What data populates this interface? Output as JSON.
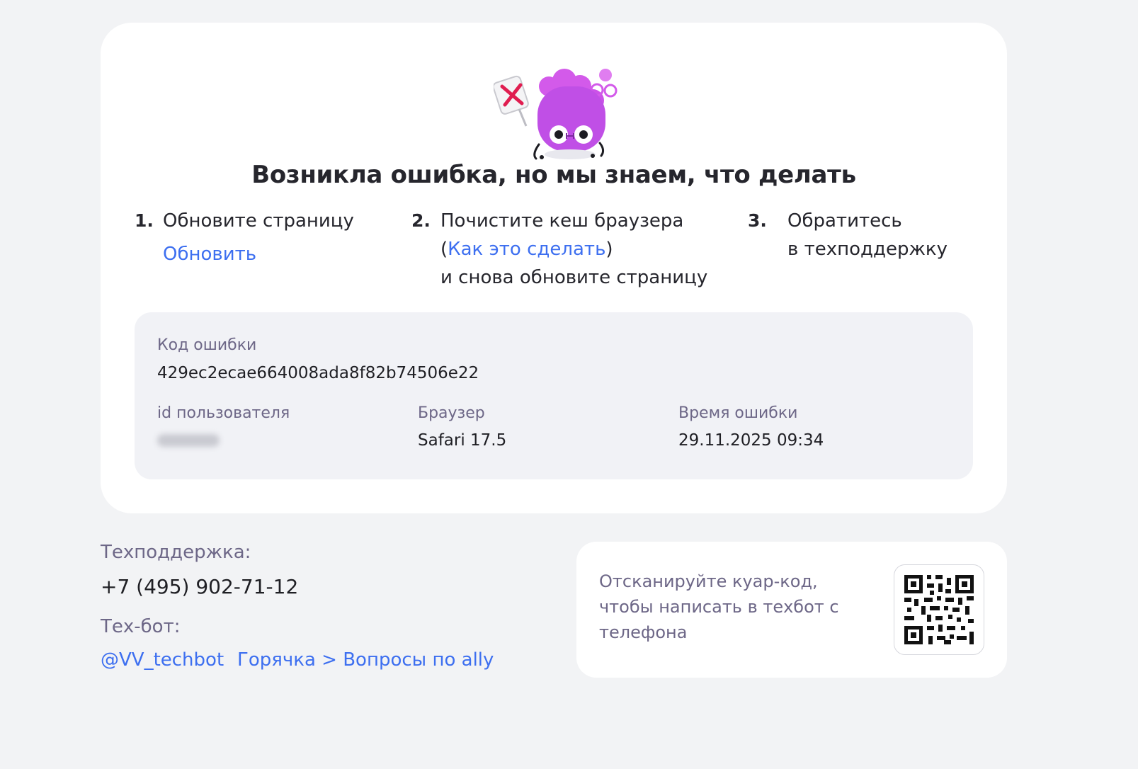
{
  "title": "Возникла ошибка, но мы знаем, что делать",
  "steps": [
    {
      "num": "1.",
      "text": "Обновите страницу",
      "link": "Обновить"
    },
    {
      "num": "2.",
      "line1": "Почистите кеш браузера",
      "paren_open": "(",
      "link": "Как это сделать",
      "paren_close": ")",
      "line3": "и снова обновите страницу"
    },
    {
      "num": "3.",
      "line1": "Обратитесь",
      "line2": "в техподдержку"
    }
  ],
  "error_info": {
    "code_label": "Код ошибки",
    "code_value": "429ec2ecae664008ada8f82b74506e22",
    "user_label": "id пользователя",
    "browser_label": "Браузер",
    "browser_value": "Safari 17.5",
    "time_label": "Время ошибки",
    "time_value": "29.11.2025 09:34"
  },
  "support": {
    "phone_label": "Техподдержка:",
    "phone": "+7 (495) 902-71-12",
    "bot_label": "Тех-бот:",
    "bot_link": "@VV_techbot",
    "chat_link": "Горячка > Вопросы по ally"
  },
  "qr": {
    "text": "Отсканируйте куар-код, чтобы написать в техбот с телефона"
  },
  "colors": {
    "accent_link": "#3d6ff0",
    "mascot": "#c04fe6",
    "muted_text": "#6d6787",
    "background": "#f2f3f5"
  },
  "icons": {
    "mascot": "error-mascot-icon",
    "qr": "qr-code-icon",
    "sign": "cross-sign-icon"
  }
}
